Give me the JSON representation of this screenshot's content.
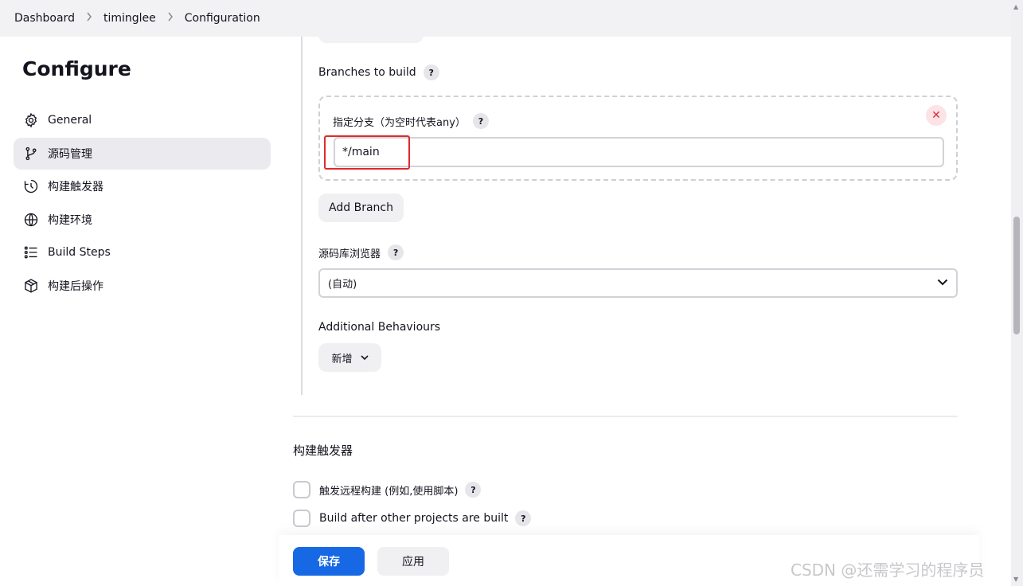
{
  "breadcrumb": {
    "items": [
      "Dashboard",
      "timinglee",
      "Configuration"
    ]
  },
  "sidebar": {
    "title": "Configure",
    "items": [
      {
        "label": "General",
        "icon": "gear-icon"
      },
      {
        "label": "源码管理",
        "icon": "branch-icon",
        "active": true
      },
      {
        "label": "构建触发器",
        "icon": "clock-icon"
      },
      {
        "label": "构建环境",
        "icon": "globe-icon"
      },
      {
        "label": "Build Steps",
        "icon": "list-icon"
      },
      {
        "label": "构建后操作",
        "icon": "package-icon"
      }
    ]
  },
  "scm": {
    "branches_label": "Branches to build",
    "branch_specifier_label": "指定分支（为空时代表any）",
    "branch_value": "*/main",
    "add_branch_label": "Add Branch",
    "repo_browser_label": "源码库浏览器",
    "repo_browser_value": "(自动)",
    "additional_behaviours_label": "Additional Behaviours",
    "add_label": "新增"
  },
  "triggers": {
    "title": "构建触发器",
    "options": [
      {
        "label": "触发远程构建 (例如,使用脚本)",
        "checked": false
      },
      {
        "label": "Build after other projects are built",
        "checked": false
      }
    ]
  },
  "actions": {
    "save_label": "保存",
    "apply_label": "应用"
  },
  "watermark": "CSDN @还需学习的程序员",
  "colors": {
    "primary": "#1768e5",
    "highlight": "#e02a2a",
    "close": "#d92e3c"
  }
}
